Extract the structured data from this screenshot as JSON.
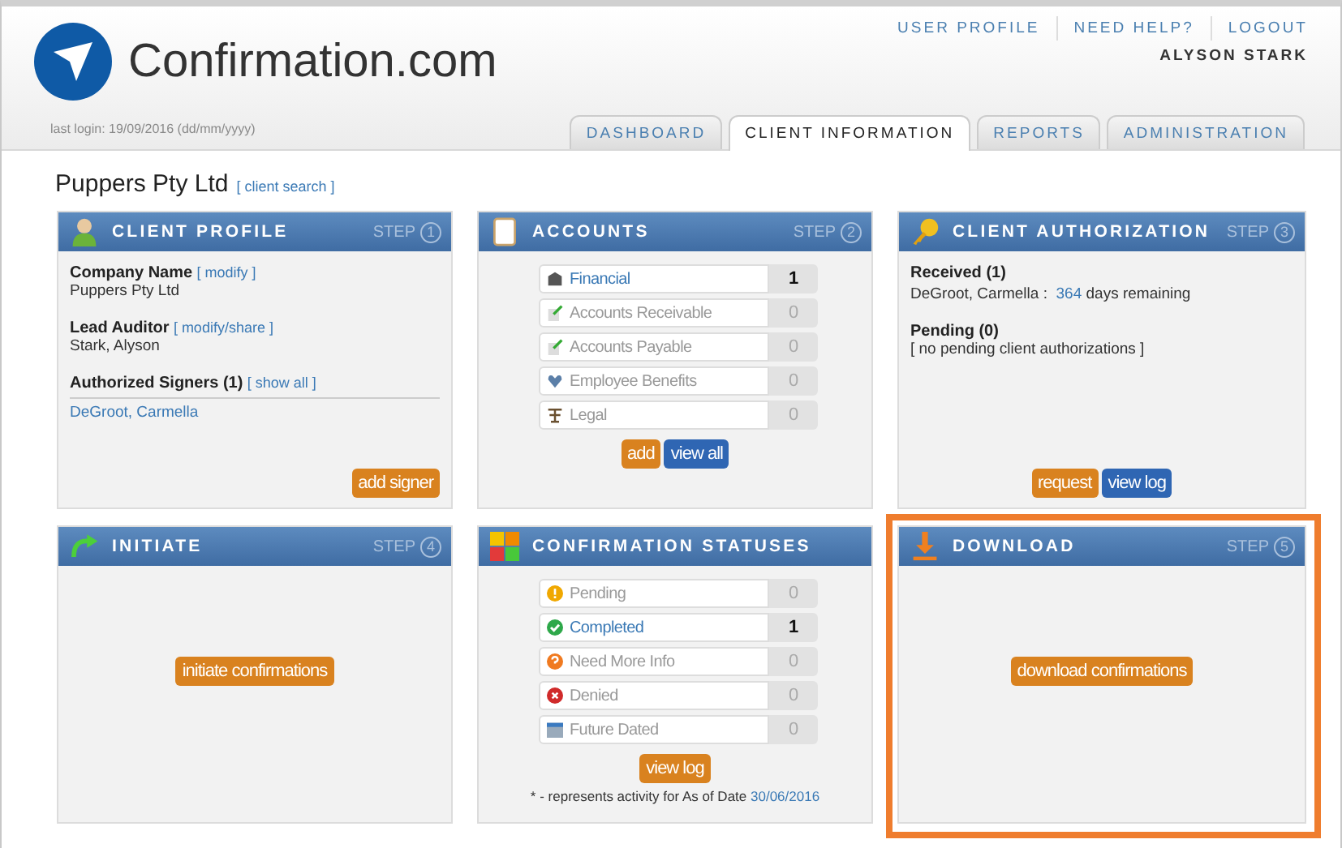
{
  "header": {
    "logo_text": "Confirmation.com",
    "nav_links": [
      "USER PROFILE",
      "NEED HELP?",
      "LOGOUT"
    ],
    "user_name": "ALYSON STARK",
    "last_login": "last login: 19/09/2016 (dd/mm/yyyy)"
  },
  "tabs": [
    {
      "label": "DASHBOARD",
      "selected": false
    },
    {
      "label": "CLIENT INFORMATION",
      "selected": true
    },
    {
      "label": "REPORTS",
      "selected": false
    },
    {
      "label": "ADMINISTRATION",
      "selected": false
    }
  ],
  "client": {
    "name": "Puppers Pty Ltd",
    "link": "[ client search ]"
  },
  "panels": [
    {
      "kind": "profile",
      "title": "CLIENT PROFILE",
      "step_label": "STEP",
      "step": "1",
      "highlighted": false,
      "fields": [
        {
          "label": "Company Name",
          "link": "[ modify ]",
          "value": "Puppers Pty Ltd",
          "value_is_link": false
        },
        {
          "label": "Lead Auditor",
          "link": "[ modify/share ]",
          "value": "Stark, Alyson",
          "value_is_link": false
        },
        {
          "label": "Authorized Signers (1)",
          "link": "[ show all ]",
          "value": "DeGroot, Carmella",
          "value_is_link": true
        }
      ],
      "buttons": [
        {
          "label": "add signer",
          "color": "#d9821f"
        }
      ]
    },
    {
      "kind": "list",
      "title": "ACCOUNTS",
      "step_label": "STEP",
      "step": "2",
      "highlighted": false,
      "rows": [
        {
          "label": "Financial",
          "count": "1",
          "active": true
        },
        {
          "label": "Accounts Receivable",
          "count": "0",
          "active": false
        },
        {
          "label": "Accounts Payable",
          "count": "0",
          "active": false
        },
        {
          "label": "Employee Benefits",
          "count": "0",
          "active": false
        },
        {
          "label": "Legal",
          "count": "0",
          "active": false
        }
      ],
      "buttons": [
        {
          "label": "add",
          "color": "#d9821f"
        },
        {
          "label": "view all",
          "color": "#2f66b3"
        }
      ]
    },
    {
      "kind": "authorization",
      "title": "CLIENT AUTHORIZATION",
      "step_label": "STEP",
      "step": "3",
      "highlighted": false,
      "received_heading": "Received (1)",
      "received_name": "DeGroot, Carmella :",
      "days": "364",
      "days_text": "days remaining",
      "pending_heading": "Pending (0)",
      "pending_text": "[ no pending client authorizations ]",
      "buttons": [
        {
          "label": "request",
          "color": "#d9821f"
        },
        {
          "label": "view log",
          "color": "#2f66b3"
        }
      ]
    },
    {
      "kind": "action",
      "title": "INITIATE",
      "step_label": "STEP",
      "step": "4",
      "highlighted": false,
      "buttons": [
        {
          "label": "initiate confirmations",
          "color": "#d9821f"
        }
      ]
    },
    {
      "kind": "list",
      "title": "CONFIRMATION STATUSES",
      "highlighted": false,
      "rows": [
        {
          "label": "Pending",
          "count": "0",
          "active": false
        },
        {
          "label": "Completed",
          "count": "1",
          "active": true
        },
        {
          "label": "Need More Info",
          "count": "0",
          "active": false
        },
        {
          "label": "Denied",
          "count": "0",
          "active": false
        },
        {
          "label": "Future Dated",
          "count": "0",
          "active": false
        }
      ],
      "buttons": [
        {
          "label": "view log",
          "color": "#d9821f"
        }
      ],
      "footnote": "* - represents activity for As of Date",
      "footnote_date": "30/06/2016"
    },
    {
      "kind": "action",
      "title": "DOWNLOAD",
      "step_label": "STEP",
      "step": "5",
      "highlighted": true,
      "buttons": [
        {
          "label": "download confirmations",
          "color": "#d9821f"
        }
      ]
    }
  ]
}
